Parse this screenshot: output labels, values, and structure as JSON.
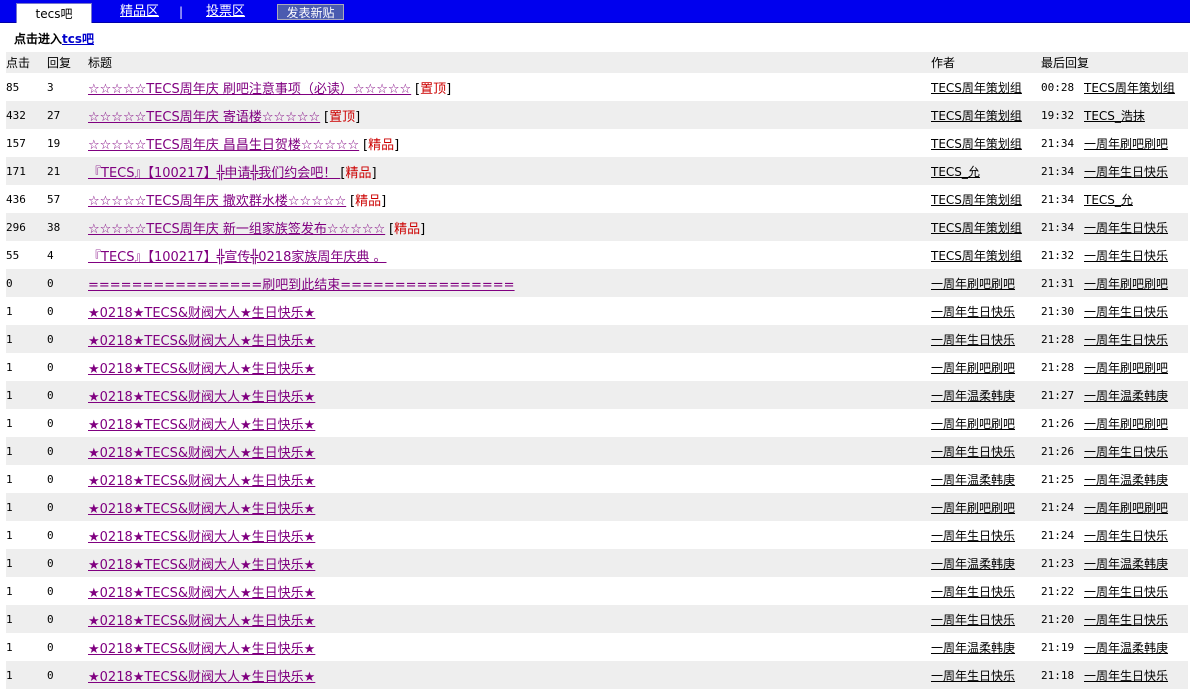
{
  "nav": {
    "active_tab": "tecs吧",
    "link1": "精品区",
    "separator": "|",
    "link2": "投票区",
    "post_button": "发表新贴"
  },
  "enter_prefix": "点击进入",
  "enter_link": "tcs吧",
  "columns": {
    "clicks": "点击",
    "replies": "回复",
    "title": "标题",
    "author": "作者",
    "last": "最后回复"
  },
  "threads": [
    {
      "clicks": "85",
      "replies": "3",
      "title": "☆☆☆☆☆TECS周年庆 刷吧注意事项（必读）☆☆☆☆☆",
      "tag": "置顶",
      "author": "TECS周年策划组",
      "time": "00:28",
      "last": "TECS周年策划组"
    },
    {
      "clicks": "432",
      "replies": "27",
      "title": "☆☆☆☆☆TECS周年庆 寄语楼☆☆☆☆☆",
      "tag": "置顶",
      "author": "TECS周年策划组",
      "time": "19:32",
      "last": "TECS_浩抹"
    },
    {
      "clicks": "157",
      "replies": "19",
      "title": "☆☆☆☆☆TECS周年庆 昌昌生日贺楼☆☆☆☆☆",
      "tag": "精品",
      "author": "TECS周年策划组",
      "time": "21:34",
      "last": "一周年刷吧刷吧"
    },
    {
      "clicks": "171",
      "replies": "21",
      "title": "『TECS』【100217】╬申请╬我们约会吧！ ",
      "tag": "精品",
      "author": "TECS_允",
      "time": "21:34",
      "last": "一周年生日快乐"
    },
    {
      "clicks": "436",
      "replies": "57",
      "title": "☆☆☆☆☆TECS周年庆 撒欢群水楼☆☆☆☆☆",
      "tag": "精品",
      "author": "TECS周年策划组",
      "time": "21:34",
      "last": "TECS_允"
    },
    {
      "clicks": "296",
      "replies": "38",
      "title": "☆☆☆☆☆TECS周年庆 新一组家族签发布☆☆☆☆☆",
      "tag": "精品",
      "author": "TECS周年策划组",
      "time": "21:34",
      "last": "一周年生日快乐"
    },
    {
      "clicks": "55",
      "replies": "4",
      "title": "『TECS』【100217】╬宣传╬0218家族周年庆典 。",
      "tag": "",
      "author": "TECS周年策划组",
      "time": "21:32",
      "last": "一周年生日快乐"
    },
    {
      "clicks": "0",
      "replies": "0",
      "title": "================刷吧到此结束================",
      "tag": "",
      "author": "一周年刷吧刷吧",
      "time": "21:31",
      "last": "一周年刷吧刷吧"
    },
    {
      "clicks": "1",
      "replies": "0",
      "title": "★0218★TECS&财阀大人★生日快乐★",
      "tag": "",
      "author": "一周年生日快乐",
      "time": "21:30",
      "last": "一周年生日快乐"
    },
    {
      "clicks": "1",
      "replies": "0",
      "title": "★0218★TECS&财阀大人★生日快乐★",
      "tag": "",
      "author": "一周年生日快乐",
      "time": "21:28",
      "last": "一周年生日快乐"
    },
    {
      "clicks": "1",
      "replies": "0",
      "title": "★0218★TECS&财阀大人★生日快乐★",
      "tag": "",
      "author": "一周年刷吧刷吧",
      "time": "21:28",
      "last": "一周年刷吧刷吧"
    },
    {
      "clicks": "1",
      "replies": "0",
      "title": "★0218★TECS&财阀大人★生日快乐★",
      "tag": "",
      "author": "一周年温柔韩庚",
      "time": "21:27",
      "last": "一周年温柔韩庚"
    },
    {
      "clicks": "1",
      "replies": "0",
      "title": "★0218★TECS&财阀大人★生日快乐★",
      "tag": "",
      "author": "一周年刷吧刷吧",
      "time": "21:26",
      "last": "一周年刷吧刷吧"
    },
    {
      "clicks": "1",
      "replies": "0",
      "title": "★0218★TECS&财阀大人★生日快乐★",
      "tag": "",
      "author": "一周年生日快乐",
      "time": "21:26",
      "last": "一周年生日快乐"
    },
    {
      "clicks": "1",
      "replies": "0",
      "title": "★0218★TECS&财阀大人★生日快乐★",
      "tag": "",
      "author": "一周年温柔韩庚",
      "time": "21:25",
      "last": "一周年温柔韩庚"
    },
    {
      "clicks": "1",
      "replies": "0",
      "title": "★0218★TECS&财阀大人★生日快乐★",
      "tag": "",
      "author": "一周年刷吧刷吧",
      "time": "21:24",
      "last": "一周年刷吧刷吧"
    },
    {
      "clicks": "1",
      "replies": "0",
      "title": "★0218★TECS&财阀大人★生日快乐★",
      "tag": "",
      "author": "一周年生日快乐",
      "time": "21:24",
      "last": "一周年生日快乐"
    },
    {
      "clicks": "1",
      "replies": "0",
      "title": "★0218★TECS&财阀大人★生日快乐★",
      "tag": "",
      "author": "一周年温柔韩庚",
      "time": "21:23",
      "last": "一周年温柔韩庚"
    },
    {
      "clicks": "1",
      "replies": "0",
      "title": "★0218★TECS&财阀大人★生日快乐★",
      "tag": "",
      "author": "一周年生日快乐",
      "time": "21:22",
      "last": "一周年生日快乐"
    },
    {
      "clicks": "1",
      "replies": "0",
      "title": "★0218★TECS&财阀大人★生日快乐★",
      "tag": "",
      "author": "一周年生日快乐",
      "time": "21:20",
      "last": "一周年生日快乐"
    },
    {
      "clicks": "1",
      "replies": "0",
      "title": "★0218★TECS&财阀大人★生日快乐★",
      "tag": "",
      "author": "一周年温柔韩庚",
      "time": "21:19",
      "last": "一周年温柔韩庚"
    },
    {
      "clicks": "1",
      "replies": "0",
      "title": "★0218★TECS&财阀大人★生日快乐★",
      "tag": "",
      "author": "一周年生日快乐",
      "time": "21:18",
      "last": "一周年生日快乐"
    }
  ]
}
